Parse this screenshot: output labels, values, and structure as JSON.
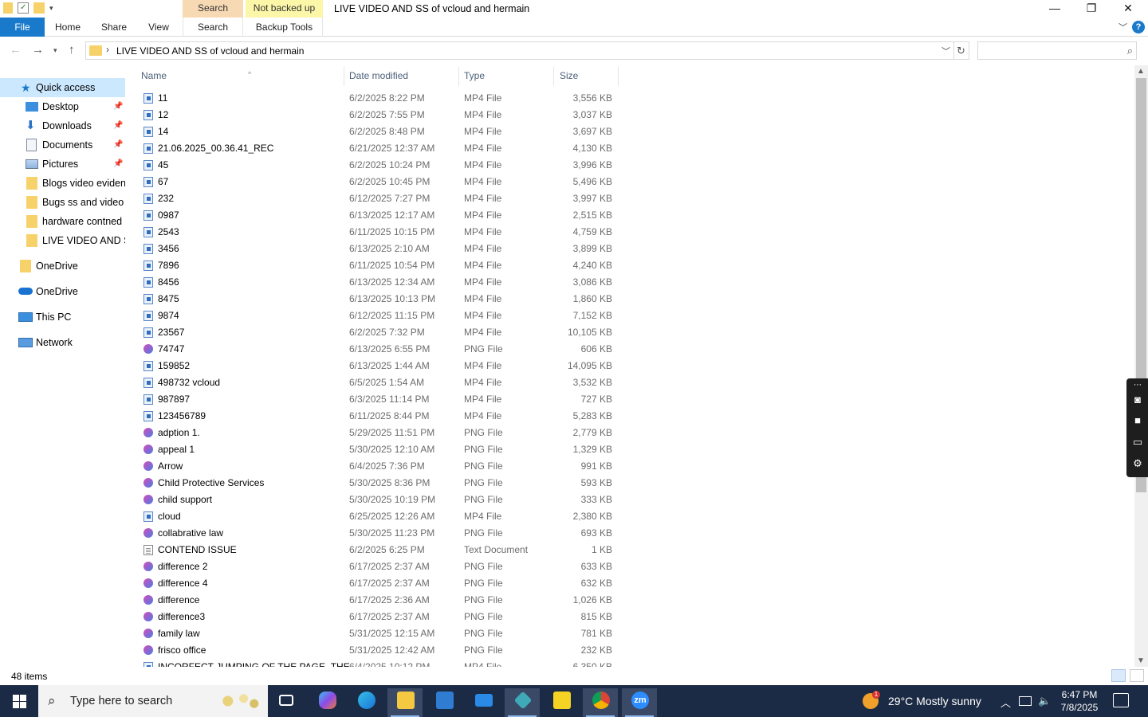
{
  "window": {
    "title": "LIVE VIDEO AND SS of vcloud and hermain",
    "context_tabs": [
      {
        "group": "Search Tools",
        "tab": "Search",
        "color": "#f7d9b4"
      },
      {
        "group": "Not backed up",
        "tab": "Backup Tools",
        "color": "#fbf6a8"
      }
    ],
    "controls": {
      "minimize": "—",
      "maximize": "❐",
      "close": "✕"
    }
  },
  "ribbon": {
    "file": "File",
    "tabs": [
      "Home",
      "Share",
      "View"
    ],
    "accent": "#1979ca",
    "help": "?"
  },
  "address": {
    "separator": "›",
    "path": "LIVE VIDEO AND SS of vcloud and hermain",
    "search_placeholder": ""
  },
  "sidebar": {
    "quick_access": "Quick access",
    "items": [
      {
        "label": "Desktop",
        "icon": "desktop-icon",
        "pinned": true
      },
      {
        "label": "Downloads",
        "icon": "downloads-icon",
        "pinned": true
      },
      {
        "label": "Documents",
        "icon": "documents-icon",
        "pinned": true
      },
      {
        "label": "Pictures",
        "icon": "pictures-icon",
        "pinned": true
      },
      {
        "label": "Blogs video evidenc",
        "icon": "folder-icon",
        "pinned": false
      },
      {
        "label": "Bugs ss and  video",
        "icon": "folder-icon",
        "pinned": false
      },
      {
        "label": "hardware contned",
        "icon": "folder-icon",
        "pinned": false
      },
      {
        "label": "LIVE VIDEO AND SS",
        "icon": "folder-icon",
        "pinned": false
      }
    ],
    "onedrive_folder": "OneDrive",
    "onedrive_cloud": "OneDrive",
    "this_pc": "This PC",
    "network": "Network",
    "pin_glyph": "📌"
  },
  "columns": {
    "name": "Name",
    "date": "Date modified",
    "type": "Type",
    "size": "Size"
  },
  "files": [
    {
      "name": "11",
      "date": "6/2/2025 8:22 PM",
      "type": "MP4 File",
      "size": "3,556 KB",
      "kind": "mp4"
    },
    {
      "name": "12",
      "date": "6/2/2025 7:55 PM",
      "type": "MP4 File",
      "size": "3,037 KB",
      "kind": "mp4"
    },
    {
      "name": "14",
      "date": "6/2/2025 8:48 PM",
      "type": "MP4 File",
      "size": "3,697 KB",
      "kind": "mp4"
    },
    {
      "name": "21.06.2025_00.36.41_REC",
      "date": "6/21/2025 12:37 AM",
      "type": "MP4 File",
      "size": "4,130 KB",
      "kind": "mp4"
    },
    {
      "name": "45",
      "date": "6/2/2025 10:24 PM",
      "type": "MP4 File",
      "size": "3,996 KB",
      "kind": "mp4"
    },
    {
      "name": "67",
      "date": "6/2/2025 10:45 PM",
      "type": "MP4 File",
      "size": "5,496 KB",
      "kind": "mp4"
    },
    {
      "name": "232",
      "date": "6/12/2025 7:27 PM",
      "type": "MP4 File",
      "size": "3,997 KB",
      "kind": "mp4"
    },
    {
      "name": "0987",
      "date": "6/13/2025 12:17 AM",
      "type": "MP4 File",
      "size": "2,515 KB",
      "kind": "mp4"
    },
    {
      "name": "2543",
      "date": "6/11/2025 10:15 PM",
      "type": "MP4 File",
      "size": "4,759 KB",
      "kind": "mp4"
    },
    {
      "name": "3456",
      "date": "6/13/2025 2:10 AM",
      "type": "MP4 File",
      "size": "3,899 KB",
      "kind": "mp4"
    },
    {
      "name": "7896",
      "date": "6/11/2025 10:54 PM",
      "type": "MP4 File",
      "size": "4,240 KB",
      "kind": "mp4"
    },
    {
      "name": "8456",
      "date": "6/13/2025 12:34 AM",
      "type": "MP4 File",
      "size": "3,086 KB",
      "kind": "mp4"
    },
    {
      "name": "8475",
      "date": "6/13/2025 10:13 PM",
      "type": "MP4 File",
      "size": "1,860 KB",
      "kind": "mp4"
    },
    {
      "name": "9874",
      "date": "6/12/2025 11:15 PM",
      "type": "MP4 File",
      "size": "7,152 KB",
      "kind": "mp4"
    },
    {
      "name": "23567",
      "date": "6/2/2025 7:32 PM",
      "type": "MP4 File",
      "size": "10,105 KB",
      "kind": "mp4"
    },
    {
      "name": "74747",
      "date": "6/13/2025 6:55 PM",
      "type": "PNG File",
      "size": "606 KB",
      "kind": "png"
    },
    {
      "name": "159852",
      "date": "6/13/2025 1:44 AM",
      "type": "MP4 File",
      "size": "14,095 KB",
      "kind": "mp4"
    },
    {
      "name": "498732 vcloud",
      "date": "6/5/2025 1:54 AM",
      "type": "MP4 File",
      "size": "3,532 KB",
      "kind": "mp4"
    },
    {
      "name": "987897",
      "date": "6/3/2025 11:14 PM",
      "type": "MP4 File",
      "size": "727 KB",
      "kind": "mp4"
    },
    {
      "name": "123456789",
      "date": "6/11/2025 8:44 PM",
      "type": "MP4 File",
      "size": "5,283 KB",
      "kind": "mp4"
    },
    {
      "name": "adption 1.",
      "date": "5/29/2025 11:51 PM",
      "type": "PNG File",
      "size": "2,779 KB",
      "kind": "png"
    },
    {
      "name": "appeal 1",
      "date": "5/30/2025 12:10 AM",
      "type": "PNG File",
      "size": "1,329 KB",
      "kind": "png"
    },
    {
      "name": "Arrow",
      "date": "6/4/2025 7:36 PM",
      "type": "PNG File",
      "size": "991 KB",
      "kind": "png"
    },
    {
      "name": "Child Protective Services",
      "date": "5/30/2025 8:36 PM",
      "type": "PNG File",
      "size": "593 KB",
      "kind": "png"
    },
    {
      "name": "child support",
      "date": "5/30/2025 10:19 PM",
      "type": "PNG File",
      "size": "333 KB",
      "kind": "png"
    },
    {
      "name": "cloud",
      "date": "6/25/2025 12:26 AM",
      "type": "MP4 File",
      "size": "2,380 KB",
      "kind": "mp4"
    },
    {
      "name": "collabrative law",
      "date": "5/30/2025 11:23 PM",
      "type": "PNG File",
      "size": "693 KB",
      "kind": "png"
    },
    {
      "name": "CONTEND ISSUE",
      "date": "6/2/2025 6:25 PM",
      "type": "Text Document",
      "size": "1 KB",
      "kind": "txt"
    },
    {
      "name": "difference 2",
      "date": "6/17/2025 2:37 AM",
      "type": "PNG File",
      "size": "633 KB",
      "kind": "png"
    },
    {
      "name": "difference 4",
      "date": "6/17/2025 2:37 AM",
      "type": "PNG File",
      "size": "632 KB",
      "kind": "png"
    },
    {
      "name": "difference",
      "date": "6/17/2025 2:36 AM",
      "type": "PNG File",
      "size": "1,026 KB",
      "kind": "png"
    },
    {
      "name": "difference3",
      "date": "6/17/2025 2:37 AM",
      "type": "PNG File",
      "size": "815 KB",
      "kind": "png"
    },
    {
      "name": "family law",
      "date": "5/31/2025 12:15 AM",
      "type": "PNG File",
      "size": "781 KB",
      "kind": "png"
    },
    {
      "name": "frisco office",
      "date": "5/31/2025 12:42 AM",
      "type": "PNG File",
      "size": "232 KB",
      "kind": "png"
    },
    {
      "name": "INCORFECT JUMPING OF THE PAGE_THE",
      "date": "6/4/2025 10:12 PM",
      "type": "MP4 File",
      "size": "6,350 KB",
      "kind": "mp4"
    }
  ],
  "status": {
    "item_count": "48 items"
  },
  "taskbar": {
    "search_placeholder": "Type here to search",
    "apps": [
      "task-view",
      "copilot",
      "edge",
      "file-explorer",
      "microsoft-store",
      "mail",
      "app-diamond",
      "sticky-notes",
      "chrome",
      "zoom"
    ],
    "zoom_label": "zm",
    "weather_badge": "1",
    "weather": "29°C  Mostly sunny",
    "time": "6:47 PM",
    "date": "7/8/2025"
  }
}
